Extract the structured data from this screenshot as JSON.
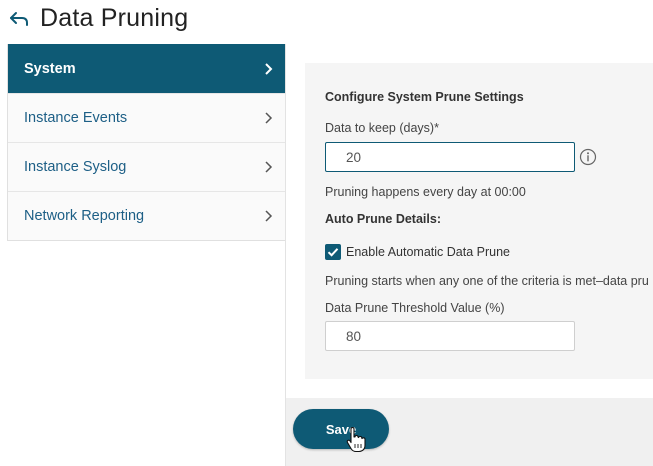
{
  "header": {
    "title": "Data Pruning"
  },
  "sidebar": {
    "items": [
      {
        "label": "System",
        "active": true
      },
      {
        "label": "Instance Events",
        "active": false
      },
      {
        "label": "Instance Syslog",
        "active": false
      },
      {
        "label": "Network Reporting",
        "active": false
      }
    ]
  },
  "form": {
    "heading": "Configure System Prune Settings",
    "days_label": "Data to keep (days)*",
    "days_value": "20",
    "schedule_text": "Pruning happens every day at 00:00",
    "auto_heading": "Auto Prune Details:",
    "enable_label": "Enable Automatic Data Prune",
    "enable_checked": true,
    "criteria_text": "Pruning starts when any one of the criteria is met–data pru",
    "threshold_label": "Data Prune Threshold Value (%)",
    "threshold_value": "80"
  },
  "footer": {
    "save_label": "Save"
  },
  "colors": {
    "accent": "#0e5a75",
    "link": "#1d5f86",
    "panel_bg": "#f5f5f5"
  }
}
